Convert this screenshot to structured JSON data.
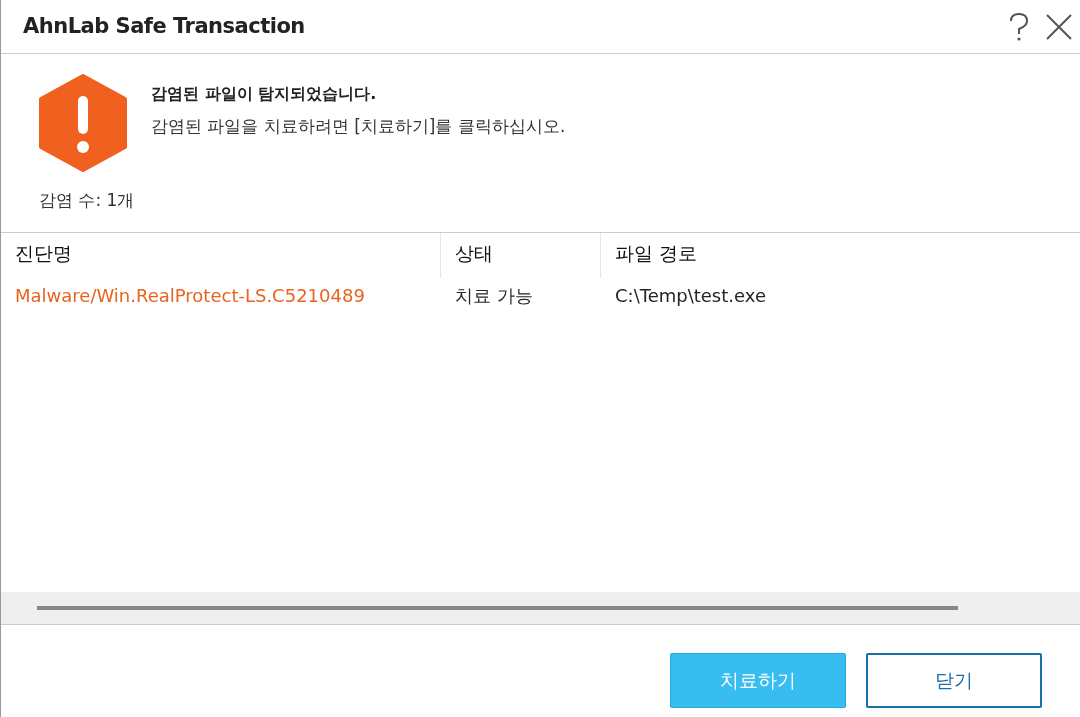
{
  "window": {
    "title": "AhnLab Safe Transaction"
  },
  "message": {
    "title": "감염된 파일이 탐지되었습니다.",
    "detail": "감염된 파일을 치료하려면 [치료하기]를 클릭하십시오."
  },
  "infection_count": "감염 수: 1개",
  "table": {
    "columns": [
      "진단명",
      "상태",
      "파일 경로"
    ],
    "rows": [
      {
        "cells": [
          "Malware/Win.RealProtect-LS.C5210489",
          "치료 가능",
          "C:\\Temp\\test.exe"
        ]
      }
    ]
  },
  "buttons": [
    {
      "label": "치료하기",
      "kind": "primary"
    },
    {
      "label": "닫기",
      "kind": "secondary"
    }
  ]
}
